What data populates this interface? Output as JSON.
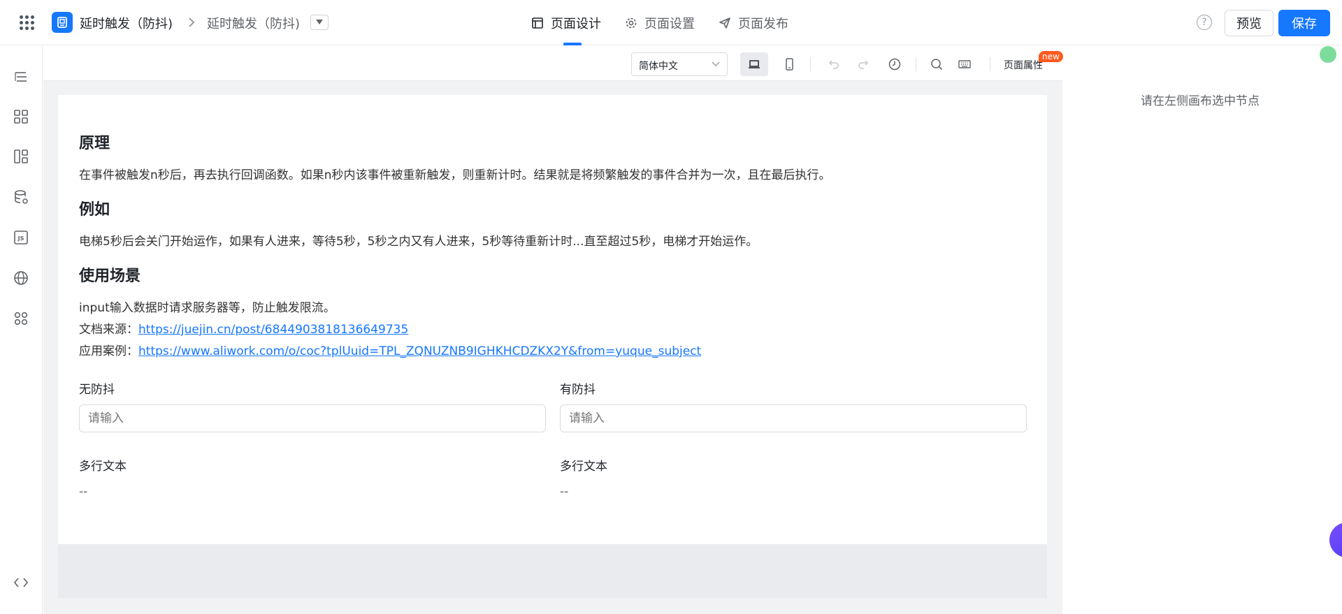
{
  "header": {
    "app_name": "延时触发（防抖)",
    "page_name": "延时触发（防抖)",
    "tabs": [
      {
        "label": "页面设计",
        "icon": "layout-icon",
        "active": true
      },
      {
        "label": "页面设置",
        "icon": "gear-icon",
        "active": false
      },
      {
        "label": "页面发布",
        "icon": "send-icon",
        "active": false
      }
    ],
    "help_symbol": "?",
    "preview_label": "预览",
    "save_label": "保存",
    "accent_color": "#1677ff"
  },
  "sidebar": {
    "items": [
      {
        "name": "outline-icon"
      },
      {
        "name": "components-icon"
      },
      {
        "name": "layout-template-icon"
      },
      {
        "name": "data-source-icon"
      },
      {
        "name": "js-icon"
      },
      {
        "name": "globe-icon"
      },
      {
        "name": "apps-icon"
      },
      {
        "name": "code-icon"
      }
    ]
  },
  "toolbar": {
    "language": "简体中文",
    "page_props_label": "页面属性",
    "new_badge": "new"
  },
  "content": {
    "h1": "原理",
    "p1": "在事件被触发n秒后，再去执行回调函数。如果n秒内该事件被重新触发，则重新计时。结果就是将频繁触发的事件合并为一次，且在最后执行。",
    "h2": "例如",
    "p2": "电梯5秒后会关门开始运作，如果有人进来，等待5秒，5秒之内又有人进来，5秒等待重新计时...直至超过5秒，电梯才开始运作。",
    "h3": "使用场景",
    "p3": "input输入数据时请求服务器等，防止触发限流。",
    "source_label": "文档来源：",
    "source_link": "https://juejin.cn/post/6844903818136649735",
    "case_label": "应用案例：",
    "case_link": "https://www.aliwork.com/o/coc?tplUuid=TPL_ZQNUZNB9IGHKHCDZKX2Y&from=yuque_subject"
  },
  "form": {
    "left_label": "无防抖",
    "right_label": "有防抖",
    "placeholder": "请输入",
    "textarea_left_label": "多行文本",
    "textarea_right_label": "多行文本",
    "textarea_left_value": "--",
    "textarea_right_value": "--"
  },
  "right_panel": {
    "hint": "请在左侧画布选中节点"
  }
}
